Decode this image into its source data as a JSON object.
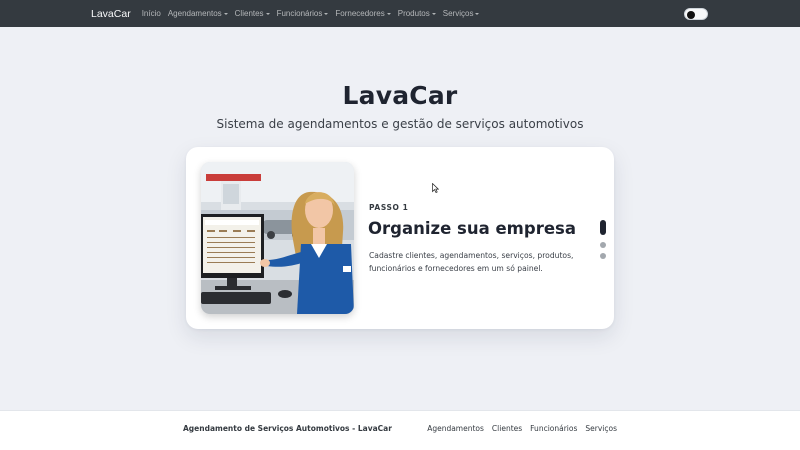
{
  "navbar": {
    "brand": "LavaCar",
    "items": [
      {
        "label": "Início",
        "dropdown": false
      },
      {
        "label": "Agendamentos",
        "dropdown": true
      },
      {
        "label": "Clientes",
        "dropdown": true
      },
      {
        "label": "Funcionários",
        "dropdown": true
      },
      {
        "label": "Fornecedores",
        "dropdown": true
      },
      {
        "label": "Produtos",
        "dropdown": true
      },
      {
        "label": "Serviços",
        "dropdown": true
      }
    ],
    "theme_toggle": "dark-mode-toggle"
  },
  "hero": {
    "title": "LavaCar",
    "subtitle": "Sistema de agendamentos e gestão de serviços automotivos"
  },
  "carousel": {
    "step_label": "PASSO 1",
    "step_title": "Organize sua empresa",
    "step_description": "Cadastre clientes, agendamentos, serviços, produtos, funcionários e fornecedores em um só painel.",
    "image_icon": "woman-at-computer-illustration",
    "slides_count": 3,
    "active_slide": 1
  },
  "footer": {
    "text": "Agendamento de Serviços Automotivos - LavaCar",
    "links": [
      "Agendamentos",
      "Clientes",
      "Funcionários",
      "Serviços"
    ]
  },
  "colors": {
    "navbar_bg": "#343a40",
    "page_bg": "#eef0f5",
    "card_bg": "#ffffff",
    "title": "#1f2430",
    "accent_blue": "#1e5aa8"
  }
}
